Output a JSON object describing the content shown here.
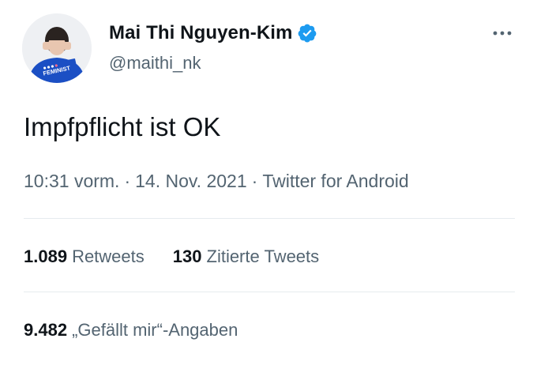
{
  "author": {
    "display_name": "Mai Thi Nguyen-Kim",
    "handle": "@maithi_nk",
    "verified": true,
    "verified_icon": "verified-badge-icon",
    "avatar_shirt_text": "FEMINIST",
    "avatar_shirt_color": "#1b4fc4"
  },
  "menu": {
    "icon": "more-horizontal-icon"
  },
  "tweet": {
    "text": "Impfpflicht ist OK",
    "time": "10:31 vorm.",
    "date": "14. Nov. 2021",
    "source": "Twitter for Android",
    "separator": "·"
  },
  "stats": {
    "retweets": {
      "count": "1.089",
      "label": "Retweets"
    },
    "quotes": {
      "count": "130",
      "label": "Zitierte Tweets"
    },
    "likes": {
      "count": "9.482",
      "label": "„Gefällt mir“-Angaben"
    }
  },
  "colors": {
    "text": "#0f1419",
    "secondary": "#536471",
    "divider": "#e6ebee",
    "verified": "#1d9bf0"
  }
}
